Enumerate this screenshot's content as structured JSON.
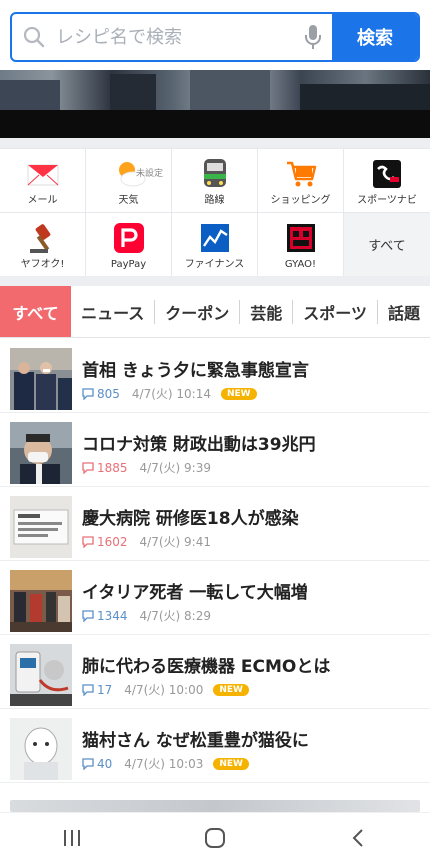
{
  "search": {
    "placeholder": "レシピ名で検索",
    "button_label": "検索"
  },
  "services": [
    {
      "label": "メール",
      "icon": "mail-icon"
    },
    {
      "label": "天気",
      "icon": "weather-icon",
      "sub": "未設定"
    },
    {
      "label": "路線",
      "icon": "train-icon"
    },
    {
      "label": "ショッピング",
      "icon": "shopping-cart-icon"
    },
    {
      "label": "スポーツナビ",
      "icon": "sportsnavi-icon"
    },
    {
      "label": "ヤフオク!",
      "icon": "auction-gavel-icon"
    },
    {
      "label": "PayPay",
      "icon": "paypay-icon"
    },
    {
      "label": "ファイナンス",
      "icon": "finance-chart-icon"
    },
    {
      "label": "GYAO!",
      "icon": "gyao-icon"
    },
    {
      "label": "すべて",
      "icon": ""
    }
  ],
  "tabs": [
    "すべて",
    "ニュース",
    "クーポン",
    "芸能",
    "スポーツ",
    "話題"
  ],
  "news": [
    {
      "title": "首相 きょう夕に緊急事態宣言",
      "comments": "805",
      "time": "4/7(火) 10:14",
      "badge": "NEW",
      "comment_color": "blue"
    },
    {
      "title": "コロナ対策 財政出動は39兆円",
      "comments": "1885",
      "time": "4/7(火) 9:39",
      "badge": "",
      "comment_color": "red"
    },
    {
      "title": "慶大病院 研修医18人が感染",
      "comments": "1602",
      "time": "4/7(火) 9:41",
      "badge": "",
      "comment_color": "red"
    },
    {
      "title": "イタリア死者 一転して大幅増",
      "comments": "1344",
      "time": "4/7(火) 8:29",
      "badge": "",
      "comment_color": "blue"
    },
    {
      "title": "肺に代わる医療機器 ECMOとは",
      "comments": "17",
      "time": "4/7(火) 10:00",
      "badge": "NEW",
      "comment_color": "blue"
    },
    {
      "title": "猫村さん なぜ松重豊が猫役に",
      "comments": "40",
      "time": "4/7(火) 10:03",
      "badge": "NEW",
      "comment_color": "blue"
    }
  ],
  "colors": {
    "accent": "#1b74e8",
    "tab_active": "#f2696e",
    "new_badge": "#f5b300"
  }
}
